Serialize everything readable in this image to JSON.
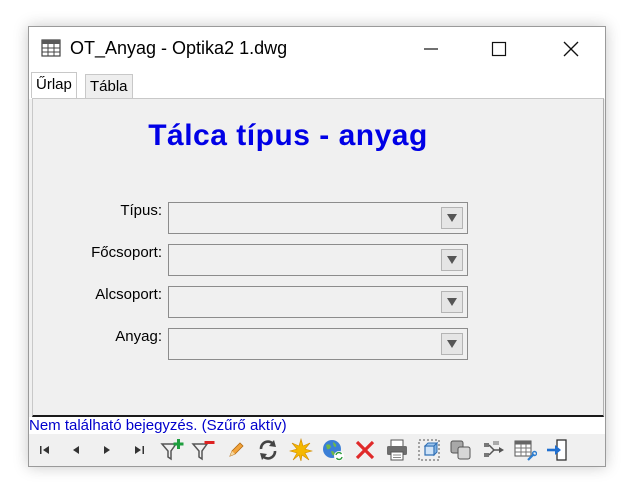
{
  "window": {
    "title": "OT_Anyag - Optika2 1.dwg",
    "controls": [
      "minimize",
      "maximize",
      "close"
    ]
  },
  "tabs": [
    {
      "label": "Űrlap",
      "active": true
    },
    {
      "label": "Tábla",
      "active": false
    }
  ],
  "form": {
    "title": "Tálca típus - anyag",
    "title_color": "#0000e6",
    "fields": [
      {
        "label": "Típus:",
        "value": ""
      },
      {
        "label": "Főcsoport:",
        "value": ""
      },
      {
        "label": "Alcsoport:",
        "value": ""
      },
      {
        "label": "Anyag:",
        "value": ""
      }
    ]
  },
  "status": {
    "text": "Nem található bejegyzés. (Szűrő aktív)",
    "color": "#0000cc"
  },
  "toolbar": {
    "icons": [
      "first-record-icon",
      "previous-record-icon",
      "next-record-icon",
      "last-record-icon",
      "add-filter-icon",
      "remove-filter-icon",
      "edit-icon",
      "refresh-icon",
      "new-record-icon",
      "globe-sync-icon",
      "delete-icon",
      "print-icon",
      "select-object-icon",
      "copy-objects-icon",
      "connect-icon",
      "table-settings-icon",
      "exit-icon"
    ]
  }
}
